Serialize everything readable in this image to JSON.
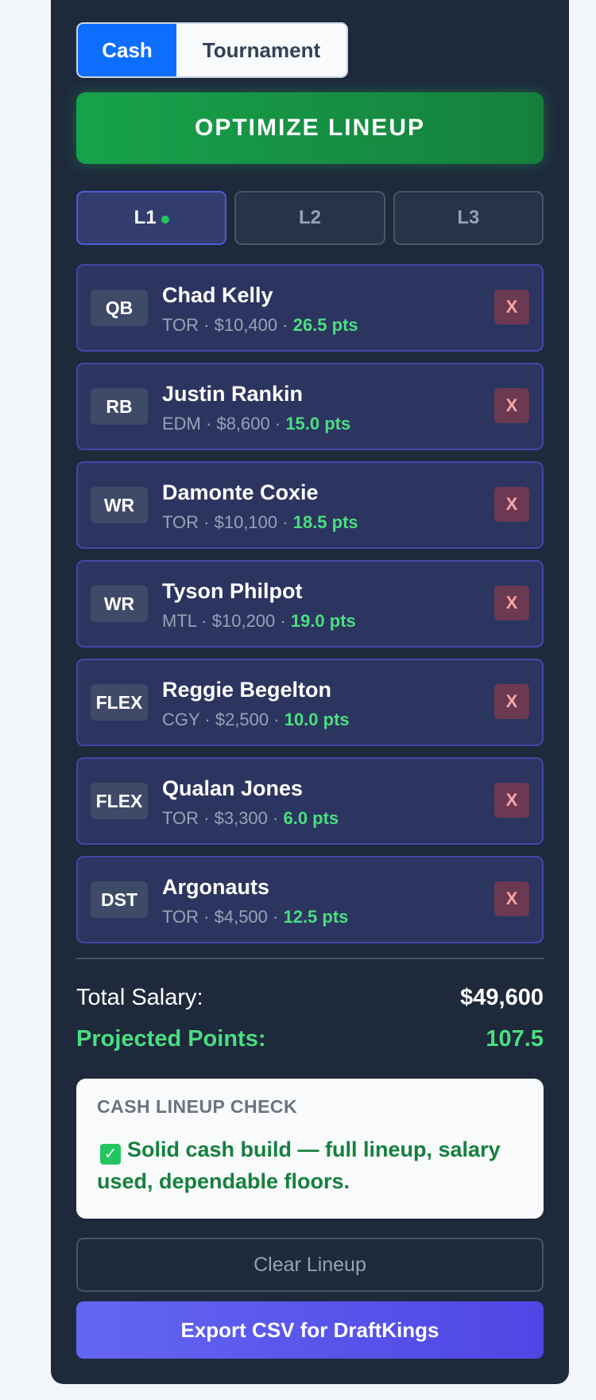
{
  "mode_toggle": {
    "cash": "Cash",
    "tournament": "Tournament",
    "selected": "Cash"
  },
  "optimize_label": "OPTIMIZE LINEUP",
  "lineup_tabs": [
    {
      "label": "L1",
      "active": true
    },
    {
      "label": "L2",
      "active": false
    },
    {
      "label": "L3",
      "active": false
    }
  ],
  "players": [
    {
      "pos": "QB",
      "name": "Chad Kelly",
      "team": "TOR",
      "salary": "$10,400",
      "pts": "26.5 pts",
      "remove": "X"
    },
    {
      "pos": "RB",
      "name": "Justin Rankin",
      "team": "EDM",
      "salary": "$8,600",
      "pts": "15.0 pts",
      "remove": "X"
    },
    {
      "pos": "WR",
      "name": "Damonte Coxie",
      "team": "TOR",
      "salary": "$10,100",
      "pts": "18.5 pts",
      "remove": "X"
    },
    {
      "pos": "WR",
      "name": "Tyson Philpot",
      "team": "MTL",
      "salary": "$10,200",
      "pts": "19.0 pts",
      "remove": "X"
    },
    {
      "pos": "FLEX",
      "name": "Reggie Begelton",
      "team": "CGY",
      "salary": "$2,500",
      "pts": "10.0 pts",
      "remove": "X"
    },
    {
      "pos": "FLEX",
      "name": "Qualan Jones",
      "team": "TOR",
      "salary": "$3,300",
      "pts": "6.0 pts",
      "remove": "X"
    },
    {
      "pos": "DST",
      "name": "Argonauts",
      "team": "TOR",
      "salary": "$4,500",
      "pts": "12.5 pts",
      "remove": "X"
    }
  ],
  "summary": {
    "salary_label": "Total Salary:",
    "salary_value": "$49,600",
    "points_label": "Projected Points:",
    "points_value": "107.5"
  },
  "check": {
    "title": "CASH LINEUP CHECK",
    "emoji": "✓",
    "message": "Solid cash build — full lineup, salary used, dependable floors."
  },
  "clear_label": "Clear Lineup",
  "export_label": "Export CSV for DraftKings",
  "colors": {
    "accent_blue": "#0d6efd",
    "accent_green": "#16a34a",
    "points_green": "#4ade80",
    "export_indigo": "#6366f1"
  }
}
